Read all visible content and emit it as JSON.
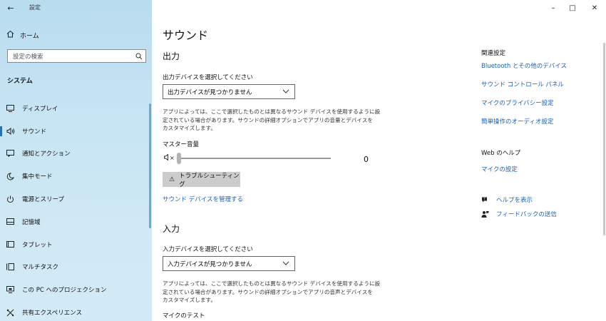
{
  "app": {
    "title": "設定",
    "back_icon": "back-arrow-icon"
  },
  "window": {
    "minimize": "–",
    "maximize": "□",
    "close": "✕"
  },
  "sidebar": {
    "home_label": "ホーム",
    "search_placeholder": "設定の検索",
    "section_title": "システム",
    "items": [
      {
        "label": "ディスプレイ",
        "icon": "display-icon"
      },
      {
        "label": "サウンド",
        "icon": "sound-icon",
        "active": true
      },
      {
        "label": "通知とアクション",
        "icon": "notification-icon"
      },
      {
        "label": "集中モード",
        "icon": "focus-moon-icon"
      },
      {
        "label": "電源とスリープ",
        "icon": "power-icon"
      },
      {
        "label": "記憶域",
        "icon": "storage-icon"
      },
      {
        "label": "タブレット",
        "icon": "tablet-icon"
      },
      {
        "label": "マルチタスク",
        "icon": "multitask-icon"
      },
      {
        "label": "この PC へのプロジェクション",
        "icon": "projection-icon"
      },
      {
        "label": "共有エクスペリエンス",
        "icon": "shared-experience-icon"
      }
    ]
  },
  "main": {
    "page_title": "サウンド",
    "output": {
      "heading": "出力",
      "select_label": "出力デバイスを選択してください",
      "select_value": "出力デバイスが見つかりません",
      "desc_lines": [
        "アプリによっては、ここで選択したものとは異なるサウンド デバイスを使用するように設",
        "定されている場合があります。サウンドの詳細オプションでアプリの音量とデバイスを",
        "カスタマイズします。"
      ],
      "master_volume_label": "マスター音量",
      "volume_muted_symbol": "×",
      "volume_value": "0",
      "volume_level": 0,
      "troubleshoot_label": "トラブルシューティング",
      "manage_link": "サウンド デバイスを管理する"
    },
    "input": {
      "heading": "入力",
      "select_label": "入力デバイスを選択してください",
      "select_value": "入力デバイスが見つかりません",
      "desc_lines": [
        "アプリによっては、ここで選択したものとは異なるサウンド デバイスを使用するように設",
        "定されている場合があります。サウンドの詳細オプションでアプリの音声とデバイスを",
        "カスタマイズします。"
      ],
      "mic_test_label": "マイクのテスト"
    }
  },
  "right": {
    "related_heading": "関連設定",
    "related_links": [
      "Bluetooth とその他のデバイス",
      "サウンド コントロール パネル",
      "マイクのプライバシー設定",
      "簡単操作のオーディオ設定"
    ],
    "web_help_heading": "Web のヘルプ",
    "web_help_link": "マイクの設定",
    "get_help": "ヘルプを表示",
    "feedback": "フィードバックの送信"
  },
  "colors": {
    "accent": "#2a6fb5",
    "link": "#1a5fb4",
    "sidebar_bg": "#c6e4f3"
  }
}
